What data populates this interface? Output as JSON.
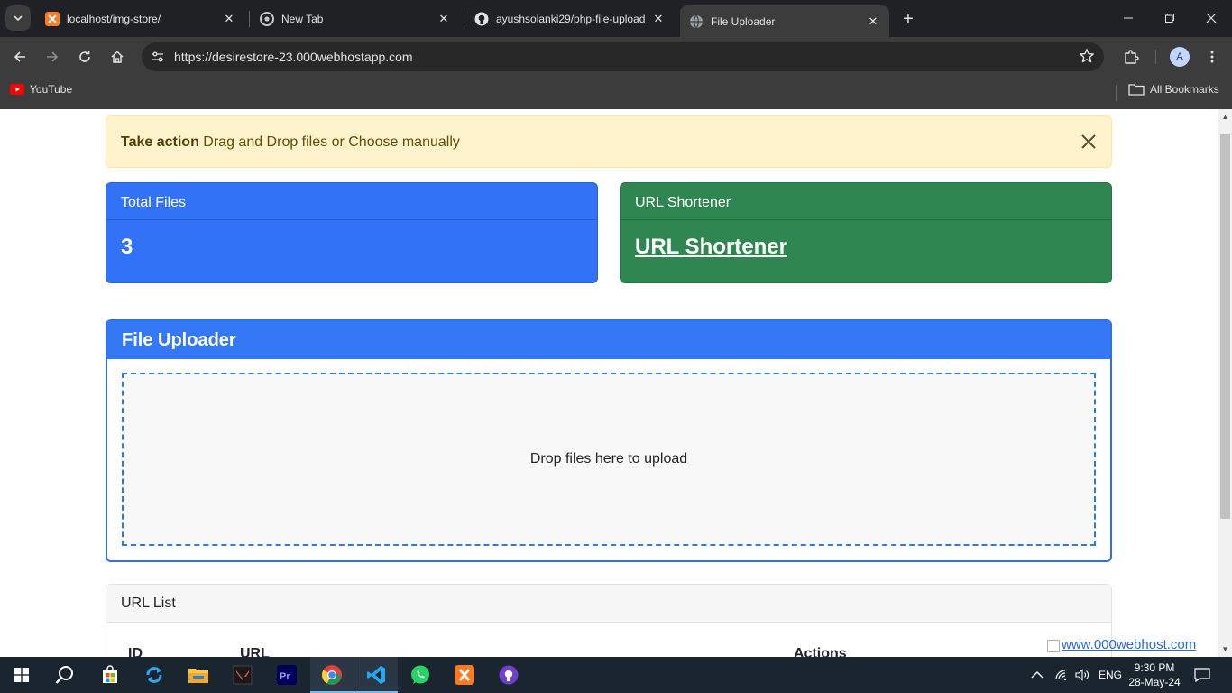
{
  "browser": {
    "tabs": [
      {
        "title": "localhost/img-store/",
        "favicon": "xampp-icon",
        "active": false
      },
      {
        "title": "New Tab",
        "favicon": "chrome-icon",
        "active": false
      },
      {
        "title": "ayushsolanki29/php-file-upload",
        "favicon": "github-icon",
        "active": false
      },
      {
        "title": "File Uploader",
        "favicon": "globe-icon",
        "active": true
      }
    ],
    "url": "https://desirestore-23.000webhostapp.com",
    "profile_initial": "A",
    "bookmarks": {
      "youtube": "YouTube",
      "all": "All Bookmarks"
    }
  },
  "page": {
    "alert": {
      "strong": "Take action",
      "text": " Drag and Drop files or Choose manually"
    },
    "total_files": {
      "header": "Total Files",
      "value": "3"
    },
    "url_shortener": {
      "header": "URL Shortener",
      "link": "URL Shortener"
    },
    "uploader": {
      "title": "File Uploader",
      "dropzone_text": "Drop files here to upload"
    },
    "url_list": {
      "title": "URL List",
      "columns": [
        "ID",
        "URL",
        "Actions"
      ]
    },
    "watermark": "www.000webhost.com"
  },
  "taskbar": {
    "lang": "ENG",
    "time": "9:30 PM",
    "date": "28-May-24"
  },
  "colors": {
    "primary": "#3272f6",
    "success": "#2f8650",
    "warning_bg": "#fff3cd"
  }
}
